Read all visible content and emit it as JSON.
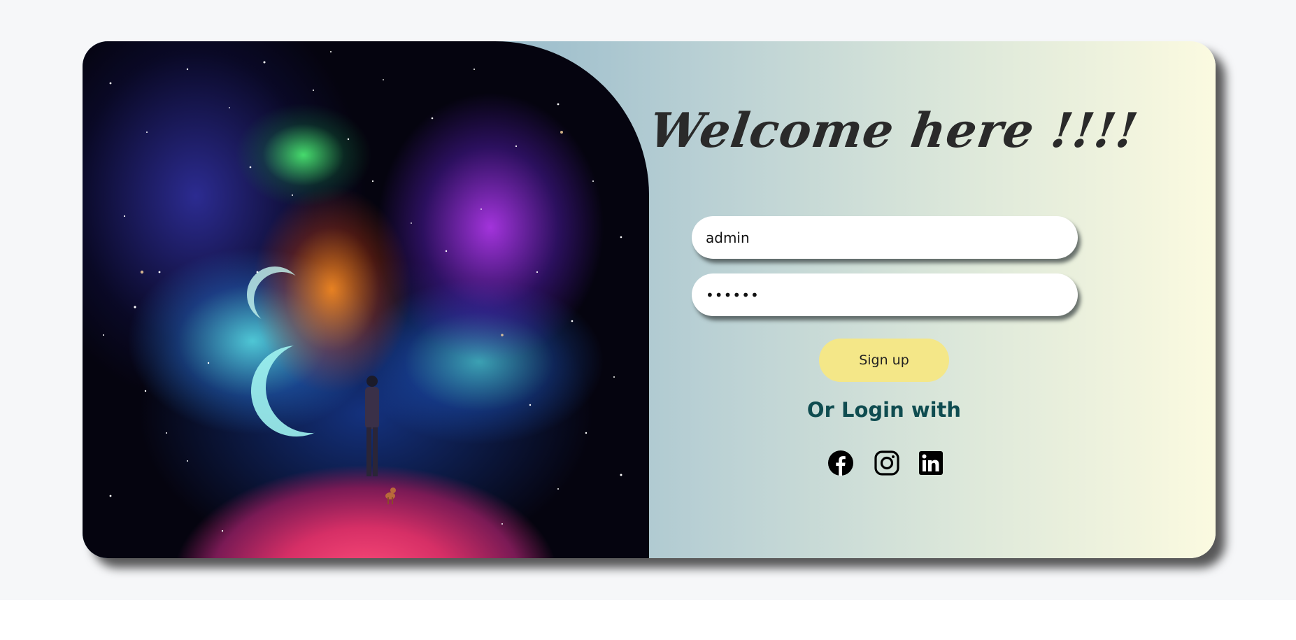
{
  "login": {
    "title": "Welcome here !!!!",
    "username_value": "admin",
    "password_value": "••••••",
    "signup_label": "Sign up",
    "or_login_label": "Or Login with",
    "social": [
      {
        "name": "facebook",
        "icon": "facebook-icon"
      },
      {
        "name": "instagram",
        "icon": "instagram-icon"
      },
      {
        "name": "linkedin",
        "icon": "linkedin-icon"
      }
    ]
  },
  "colors": {
    "page_background": "#f6f7f9",
    "card_gradient_start": "#6e9fc1",
    "card_gradient_end": "#fbfae0",
    "signup_button": "#f4e788",
    "or_login_text": "#0f4c50",
    "title_text": "#2a2a2a"
  },
  "image": {
    "subject": "space-illustration"
  }
}
